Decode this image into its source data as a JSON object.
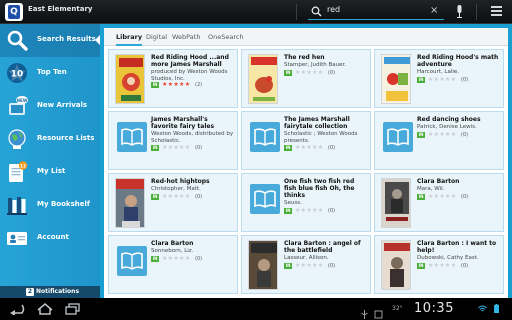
{
  "app": {
    "title": "East Elementary"
  },
  "search": {
    "query": "red",
    "clear_label": "×"
  },
  "sidebar": {
    "items": [
      {
        "label": "Search Results",
        "icon": "magnifier-icon"
      },
      {
        "label": "Top Ten",
        "icon": "top-ten-star-icon",
        "badge": "10"
      },
      {
        "label": "New Arrivals",
        "icon": "new-arrivals-icon",
        "badge": "NEW"
      },
      {
        "label": "Resource Lists",
        "icon": "globe-icon"
      },
      {
        "label": "My List",
        "icon": "my-list-icon",
        "badge": "12"
      },
      {
        "label": "My Bookshelf",
        "icon": "bookshelf-icon"
      },
      {
        "label": "Account",
        "icon": "account-card-icon"
      }
    ],
    "notifications_label": "Notifications",
    "notifications_count": "2"
  },
  "tabs": [
    {
      "label": "Library"
    },
    {
      "label": "Digital"
    },
    {
      "label": "WebPath"
    },
    {
      "label": "OneSearch"
    }
  ],
  "results": [
    {
      "title": "Red Riding Hood ...and more James Marshall",
      "author": "produced by Weston Woods Studios, Inc.",
      "cover": "cover-red-riding-hood",
      "stars": 5,
      "count": "(2)",
      "badge": "IN"
    },
    {
      "title": "The red hen",
      "author": "Stamper, Judith Bauer.",
      "cover": "cover-red-hen",
      "stars": 0,
      "count": "(0)",
      "badge": "IN"
    },
    {
      "title": "Red Riding Hood's math adventure",
      "author": "Harcourt, Lalie.",
      "cover": "cover-math-adventure",
      "stars": 0,
      "count": "(0)",
      "badge": "IN"
    },
    {
      "title": "James Marshall's favorite fairy tales",
      "author": "Weston Woods, distributed by Scholastic.",
      "cover": "generic-book-icon",
      "stars": 0,
      "count": "(0)",
      "badge": "IN"
    },
    {
      "title": "The James Marshall fairytale collection",
      "author": "Scholastic ; Weston Woods presents.",
      "cover": "generic-book-icon",
      "stars": 0,
      "count": "(0)",
      "badge": "IN"
    },
    {
      "title": "Red dancing shoes",
      "author": "Patrick, Denise Lewis.",
      "cover": "generic-book-icon",
      "stars": 0,
      "count": "(0)",
      "badge": "IN"
    },
    {
      "title": "Red-hot hightops",
      "author": "Christopher, Matt.",
      "cover": "cover-hightops",
      "stars": 0,
      "count": "(0)",
      "badge": "IN"
    },
    {
      "title": "One fish two fish red fish blue fish Oh, the thinks",
      "author": "Seuss.",
      "cover": "generic-book-icon",
      "stars": 0,
      "count": "(0)",
      "badge": "IN"
    },
    {
      "title": "Clara Barton",
      "author": "Mara, Wil.",
      "cover": "cover-clara-barton-portrait",
      "stars": 0,
      "count": "(0)",
      "badge": "IN"
    },
    {
      "title": "Clara Barton",
      "author": "Sonneborn, Liz.",
      "cover": "generic-book-icon",
      "stars": 0,
      "count": "(0)",
      "badge": "IN"
    },
    {
      "title": "Clara Barton : angel of the battlefield",
      "author": "Lasseur, Allison.",
      "cover": "cover-angel-battlefield",
      "stars": 0,
      "count": "(0)",
      "badge": "IN"
    },
    {
      "title": "Clara Barton : I want to help!",
      "author": "Dubowski, Cathy East.",
      "cover": "cover-i-want-to-help",
      "stars": 0,
      "count": "(0)",
      "badge": "IN"
    }
  ],
  "system": {
    "clock": "10:35",
    "temperature": "32°"
  },
  "colors": {
    "sidebar": "#1f9bd0",
    "accent": "#2fa8d9",
    "card": "#eaf5fb",
    "badge": "#4caf3a"
  }
}
